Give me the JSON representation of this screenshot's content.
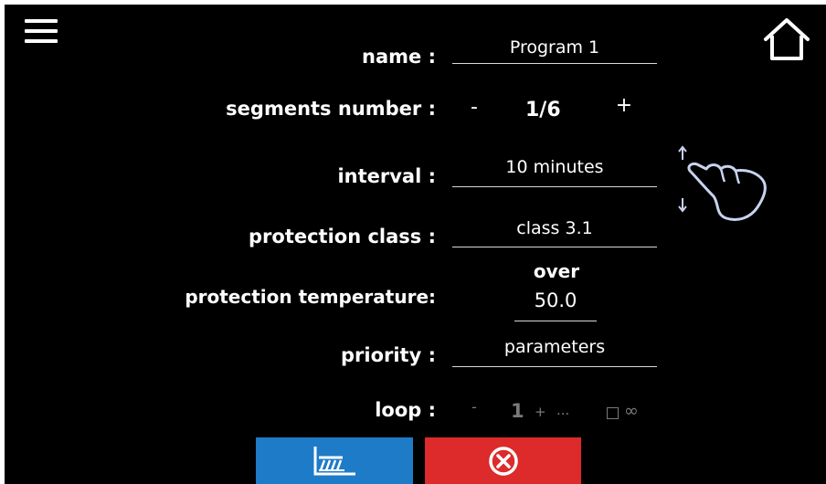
{
  "icons": {
    "menu": "hamburger-menu-icon",
    "home": "home-icon",
    "gesture": "hand-swipe-icon",
    "chart": "chart-graph-icon",
    "cancel": "cancel-circle-x-icon",
    "infinity": "infinity-icon"
  },
  "colors": {
    "background": "#000000",
    "chart_button": "#1e7bc8",
    "cancel_button": "#dd2a2a",
    "hand_icon": "#c9d3ef",
    "disabled": "#7a7a7a"
  },
  "form": {
    "name": {
      "label": "name :",
      "value": "Program 1"
    },
    "segments": {
      "label": "segments number :",
      "minus": "-",
      "value": "1/6",
      "plus": "+"
    },
    "interval": {
      "label": "interval :",
      "value": "10 minutes"
    },
    "protection_class": {
      "label": "protection class :",
      "value": "class 3.1"
    },
    "protection_temperature": {
      "label": "protection temperature:",
      "mode": "over",
      "value": "50.0"
    },
    "priority": {
      "label": "priority :",
      "value": "parameters"
    },
    "loop": {
      "label": "loop :",
      "minus": "-",
      "value": "1",
      "plus": "+",
      "ellipsis": "...",
      "infinity": "∞"
    }
  },
  "gesture_hint": {
    "arrow_up": "↑",
    "arrow_down": "↓"
  }
}
